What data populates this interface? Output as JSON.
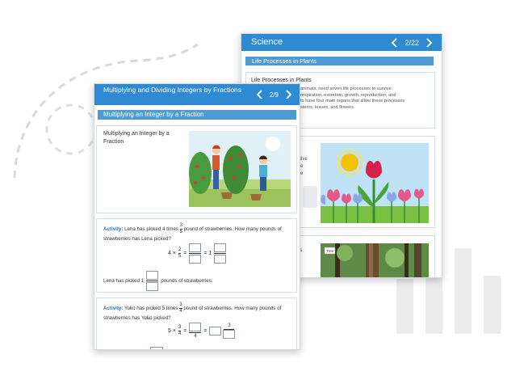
{
  "science": {
    "title": "Science",
    "page": "2/22",
    "section_banner": "Life Processes in Plants",
    "content_heading": "Life Processes in Plants",
    "content_lines": [
      "animals, need seven life processes to survive:",
      "respiration, excretion, growth, reproduction, and",
      "to have four main organs that allow these processes",
      "stems, leaves, and flowers."
    ],
    "side_text_1": [
      "sitive",
      "the",
      "the"
    ],
    "side_text_2": [
      "e is",
      "s"
    ],
    "tag_label": "Tree"
  },
  "math": {
    "title": "Multiplying and Dividing Integers by Fractions",
    "page": "2/9",
    "section_banner": "Multiplying an Integer by a Fraction",
    "intro_label": "Multiplying an Integer by a Fraction",
    "activity1": {
      "prefix": "Activity:",
      "text_before": "Lena has picked 4 times",
      "fraction": {
        "num": "3",
        "den": "5"
      },
      "text_after": "pound of strawberries. How many pounds of strawberries has Lena picked?",
      "eq_left": "4 ×",
      "eq_frac": {
        "num": "2",
        "den": "5"
      },
      "eq_mid": "= 1",
      "answer_before": "Lena has picked 1",
      "answer_after": "pounds of strawberries."
    },
    "activity2": {
      "prefix": "Activity:",
      "text_before": "Yoko has picked 5 times",
      "fraction": {
        "num": "3",
        "den": "4"
      },
      "text_after": "pound of strawberries. How many pounds of strawberries has Yoko picked?",
      "eq_left": "5 ×",
      "eq_frac": {
        "num": "3",
        "den": "4"
      },
      "eq_right_num": "3"
    }
  },
  "colors": {
    "header": "#2d8ad3",
    "banner": "#4e9bd3",
    "activity_label": "#2d6fb3"
  }
}
